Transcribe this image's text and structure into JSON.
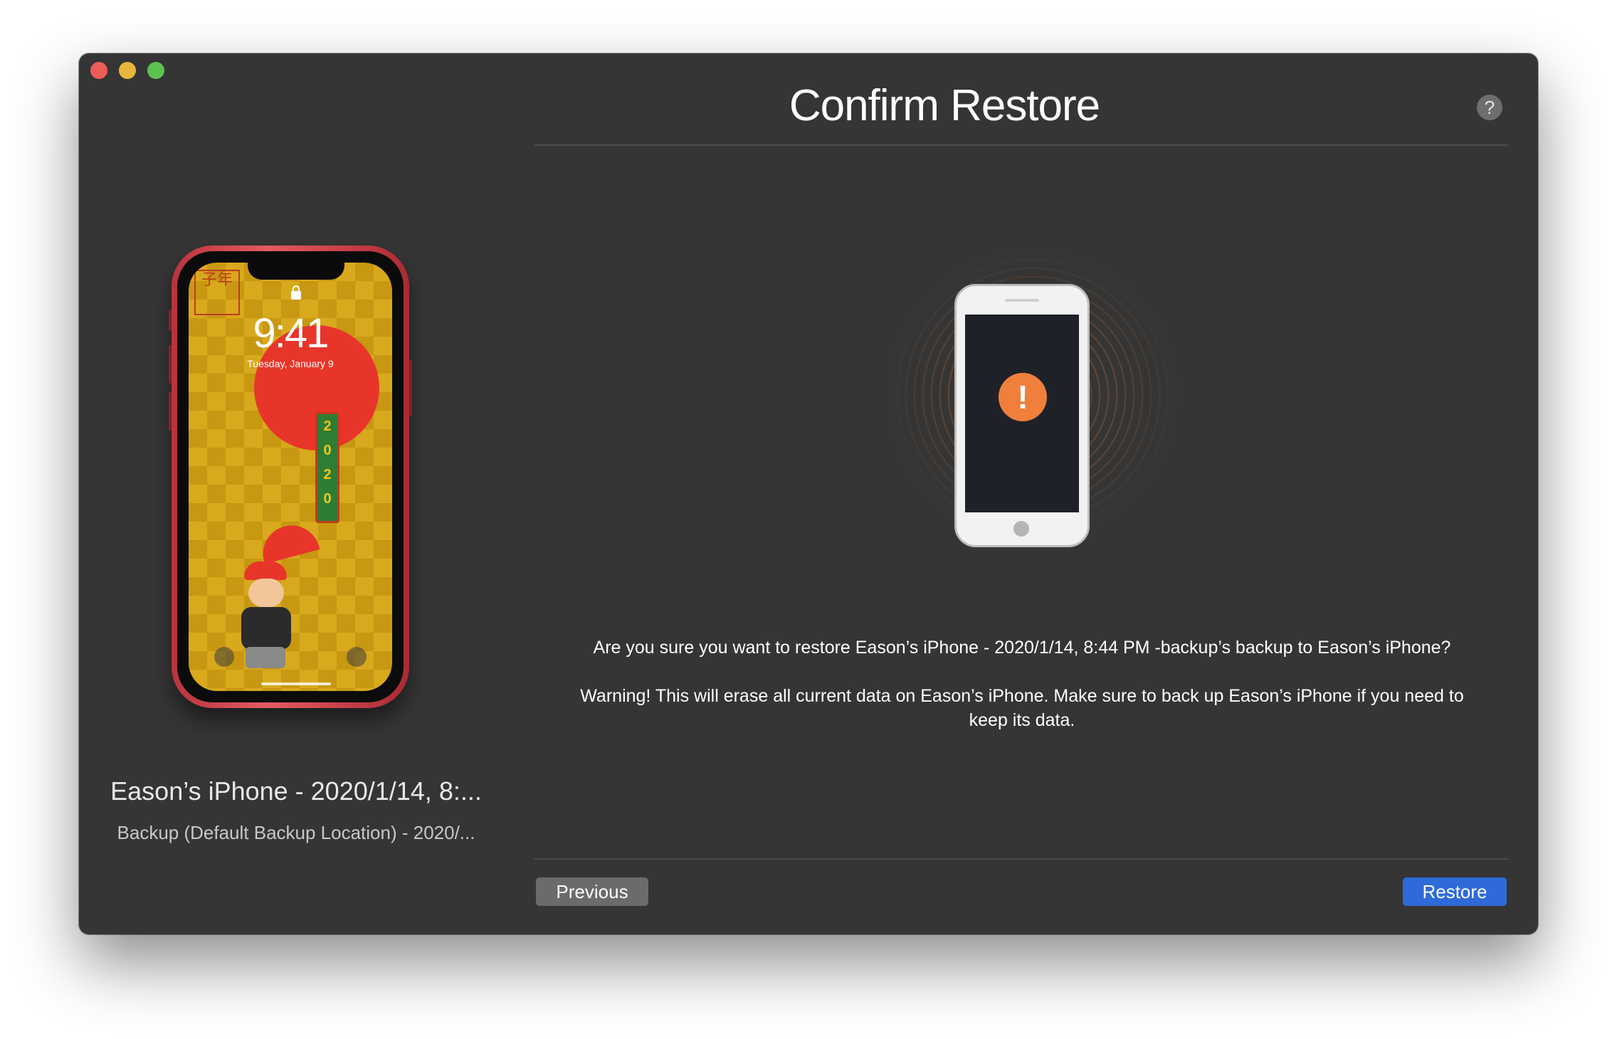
{
  "window": {
    "controls": [
      "close",
      "minimize",
      "zoom"
    ]
  },
  "header": {
    "title": "Confirm Restore",
    "help_label": "?"
  },
  "source_device": {
    "lock_time": "9:41",
    "lock_date": "Tuesday, January 9",
    "wallpaper_banner": [
      "2",
      "0",
      "2",
      "0"
    ],
    "wallpaper_stamp": "子年",
    "name": "Eason’s iPhone - 2020/1/14, 8:...",
    "subtitle": "Backup (Default Backup Location) - 2020/..."
  },
  "target_device": {
    "alert_glyph": "!",
    "alert_color": "#f07f3c"
  },
  "message": {
    "question": "Are you sure you want to restore Eason’s iPhone - 2020/1/14, 8:44 PM -backup’s backup to Eason’s iPhone?",
    "warning": "Warning! This will erase all current data on Eason’s iPhone. Make sure to back up Eason’s iPhone if you need to keep its data."
  },
  "footer": {
    "previous_label": "Previous",
    "restore_label": "Restore"
  },
  "colors": {
    "window_bg": "#353535",
    "primary_button": "#2e6bd9",
    "secondary_button": "#6b6b6b",
    "close": "#ec5d57",
    "minimize": "#e6b73c",
    "zoom": "#5cc14e"
  }
}
